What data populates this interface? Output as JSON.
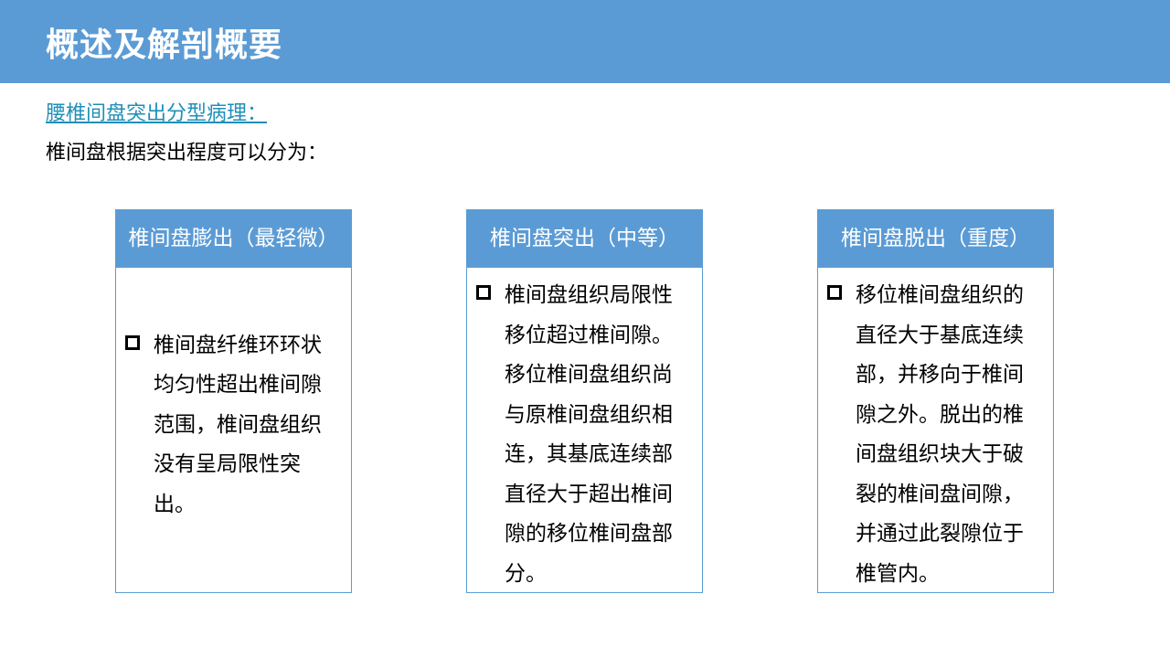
{
  "header": {
    "title": "概述及解剖概要"
  },
  "section": {
    "link_text": "腰椎间盘突出分型病理：",
    "intro_text": "椎间盘根据突出程度可以分为："
  },
  "cards": [
    {
      "title": "椎间盘膨出（最轻微）",
      "bullet": "椎间盘纤维环环状均匀性超出椎间隙范围，椎间盘组织没有呈局限性突出。"
    },
    {
      "title": "椎间盘突出（中等）",
      "bullet": "椎间盘组织局限性移位超过椎间隙。移位椎间盘组织尚与原椎间盘组织相连，其基底连续部直径大于超出椎间隙的移位椎间盘部分。"
    },
    {
      "title": "椎间盘脱出（重度）",
      "bullet": "移位椎间盘组织的直径大于基底连续部，并移向于椎间隙之外。脱出的椎间盘组织块大于破裂的椎间盘间隙，并通过此裂隙位于椎管内。"
    }
  ],
  "colors": {
    "accent": "#5B9BD5",
    "link": "#1F8FB8"
  }
}
